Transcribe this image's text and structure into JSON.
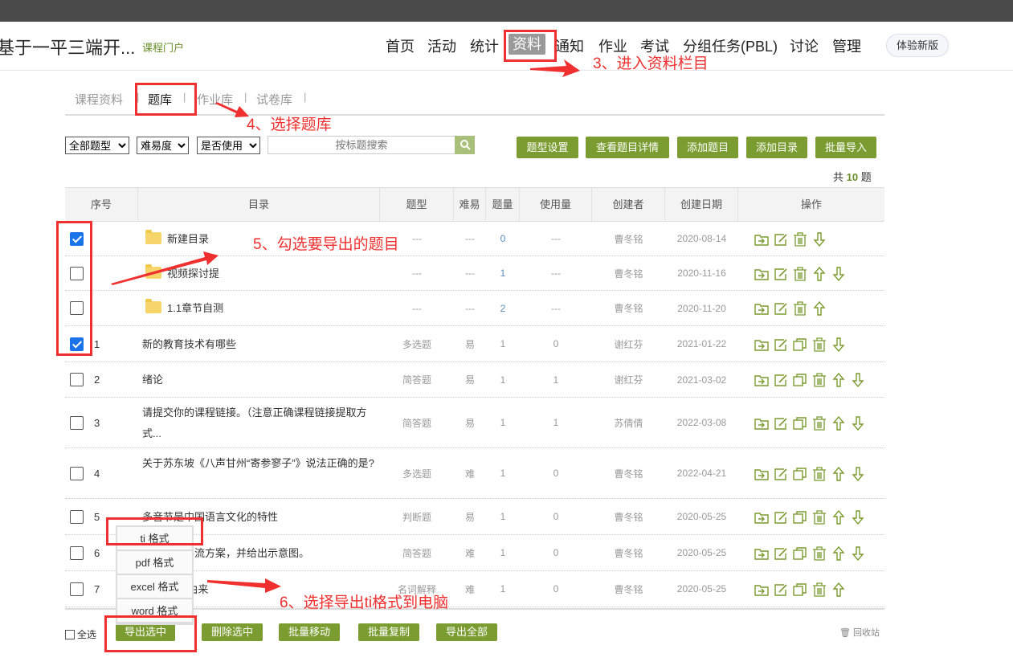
{
  "header": {
    "course_title": "基于一平三端开...",
    "portal_link": "课程门户",
    "nav": [
      "首页",
      "活动",
      "统计",
      "资料",
      "通知",
      "作业",
      "考试",
      "分组任务(PBL)",
      "讨论",
      "管理"
    ],
    "active_nav": "资料",
    "new_version": "体验新版"
  },
  "subtabs": [
    "课程资料",
    "题库",
    "作业库",
    "试卷库"
  ],
  "subtab_sep": "|",
  "filters": {
    "type": "全部题型",
    "difficulty": "难易度",
    "used": "是否使用",
    "search_placeholder": "按标题搜索"
  },
  "toolbar": [
    "题型设置",
    "查看题目详情",
    "添加题目",
    "添加目录",
    "批量导入"
  ],
  "total": {
    "prefix": "共",
    "count": "10",
    "suffix": "题"
  },
  "columns": [
    "序号",
    "目录",
    "题型",
    "难易",
    "题量",
    "使用量",
    "创建者",
    "创建日期",
    "操作"
  ],
  "rows": [
    {
      "checked": true,
      "num": "",
      "folder": true,
      "title": "新建目录",
      "type": "---",
      "diff": "---",
      "qty": "0",
      "used": "---",
      "creator": "曹冬铭",
      "date": "2020-08-14",
      "actions": [
        "move",
        "edit",
        "delete",
        "down"
      ]
    },
    {
      "checked": false,
      "num": "",
      "folder": true,
      "title": "视频探讨提",
      "type": "---",
      "diff": "---",
      "qty": "1",
      "used": "---",
      "creator": "曹冬铭",
      "date": "2020-11-16",
      "actions": [
        "move",
        "edit",
        "delete",
        "up",
        "down"
      ]
    },
    {
      "checked": false,
      "num": "",
      "folder": true,
      "title": "1.1章节自测",
      "type": "---",
      "diff": "---",
      "qty": "2",
      "used": "---",
      "creator": "曹冬铭",
      "date": "2020-11-20",
      "actions": [
        "move",
        "edit",
        "delete",
        "up"
      ]
    },
    {
      "checked": true,
      "num": "1",
      "folder": false,
      "title": "新的教育技术有哪些",
      "type": "多选题",
      "diff": "易",
      "qty": "1",
      "used": "0",
      "creator": "谢红芬",
      "date": "2021-01-22",
      "actions": [
        "move",
        "edit",
        "copy",
        "delete",
        "down"
      ]
    },
    {
      "checked": false,
      "num": "2",
      "folder": false,
      "title": "绪论",
      "type": "简答题",
      "diff": "易",
      "qty": "1",
      "used": "1",
      "creator": "谢红芬",
      "date": "2021-03-02",
      "actions": [
        "move",
        "edit",
        "copy",
        "delete",
        "up",
        "down"
      ]
    },
    {
      "checked": false,
      "num": "3",
      "folder": false,
      "title": "请提交你的课程链接。（注意正确课程链接提取方式...",
      "type": "简答题",
      "diff": "易",
      "qty": "1",
      "used": "1",
      "creator": "苏倩倩",
      "date": "2022-03-08",
      "actions": [
        "move",
        "edit",
        "copy",
        "delete",
        "up",
        "down"
      ]
    },
    {
      "checked": false,
      "num": "4",
      "folder": false,
      "title": "关于苏东坡《八声甘州“寄参寥子”》说法正确的是?",
      "type": "多选题",
      "diff": "难",
      "qty": "1",
      "used": "0",
      "creator": "曹冬铭",
      "date": "2022-04-21",
      "actions": [
        "move",
        "edit",
        "copy",
        "delete",
        "up",
        "down"
      ]
    },
    {
      "checked": false,
      "num": "5",
      "folder": false,
      "title": "多音节是中国语言文化的特性",
      "type": "判断题",
      "diff": "易",
      "qty": "1",
      "used": "0",
      "creator": "曹冬铭",
      "date": "2020-05-25",
      "actions": [
        "move",
        "edit",
        "copy",
        "delete",
        "up",
        "down"
      ]
    },
    {
      "checked": false,
      "num": "6",
      "folder": false,
      "title": "块工程的导流方案，并给出示意图。",
      "type": "简答题",
      "diff": "难",
      "qty": "1",
      "used": "0",
      "creator": "曹冬铭",
      "date": "2020-05-25",
      "actions": [
        "move",
        "edit",
        "copy",
        "delete",
        "up",
        "down"
      ]
    },
    {
      "checked": false,
      "num": "7",
      "folder": false,
      "title": "词”一词的由来",
      "type": "名词解释",
      "diff": "难",
      "qty": "1",
      "used": "0",
      "creator": "曹冬铭",
      "date": "2020-05-25",
      "actions": [
        "move",
        "edit",
        "copy",
        "delete",
        "up"
      ]
    }
  ],
  "export_menu": [
    "ti 格式",
    "pdf 格式",
    "excel 格式",
    "word 格式"
  ],
  "footer": {
    "select_all": "全选",
    "buttons": [
      "导出选中",
      "删除选中",
      "批量移动",
      "批量复制",
      "导出全部"
    ],
    "recycle": "回收站"
  },
  "annotations": [
    "3、进入资料栏目",
    "4、选择题库",
    "5、勾选要导出的题目",
    "6、选择导出ti格式到电脑"
  ],
  "colors": {
    "accent": "#7a9c30",
    "annotation": "#f0302f"
  }
}
